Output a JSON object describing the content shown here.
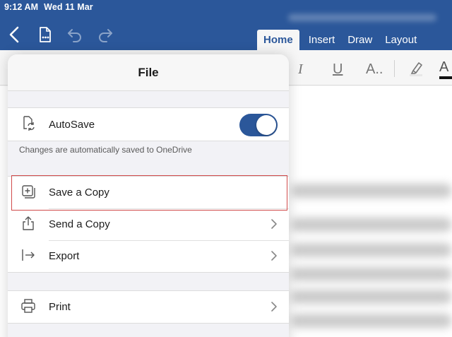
{
  "status_bar": {
    "time": "9:12 AM",
    "date": "Wed 11 Mar"
  },
  "toolbar": {
    "icons": [
      "back-chevron-icon",
      "file-menu-icon",
      "undo-icon",
      "redo-icon"
    ],
    "tabs": [
      {
        "label": "Home",
        "active": true
      },
      {
        "label": "Insert",
        "active": false
      },
      {
        "label": "Draw",
        "active": false
      },
      {
        "label": "Layout",
        "active": false
      }
    ]
  },
  "ribbon": {
    "italic": "I",
    "underline": "U",
    "font_size": "A..",
    "font_color": "A"
  },
  "file_panel": {
    "title": "File",
    "autosave": {
      "label": "AutoSave",
      "enabled": true,
      "helper": "Changes are automatically saved to OneDrive"
    },
    "items": [
      {
        "label": "Save a Copy",
        "icon": "save-copy-icon",
        "chevron": false
      },
      {
        "label": "Send a Copy",
        "icon": "share-icon",
        "chevron": true
      },
      {
        "label": "Export",
        "icon": "export-icon",
        "chevron": true
      }
    ],
    "print": {
      "label": "Print",
      "icon": "printer-icon",
      "chevron": true
    }
  },
  "colors": {
    "brand": "#2b579a",
    "highlight": "#d04a4a"
  }
}
